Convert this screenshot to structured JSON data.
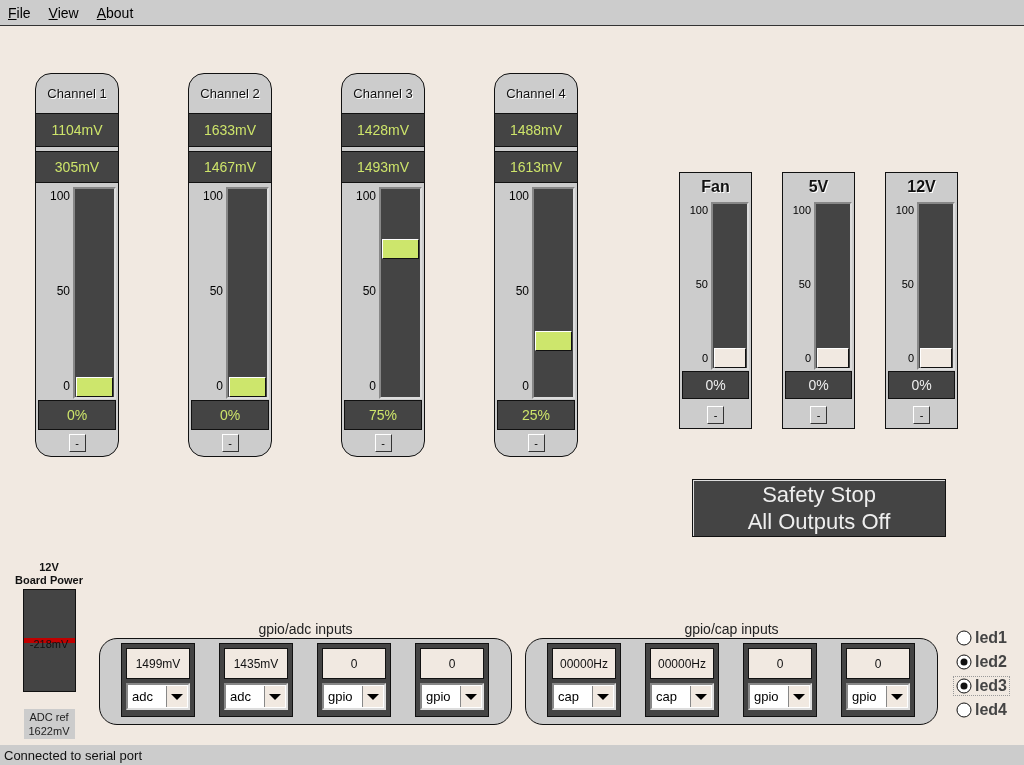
{
  "menu": [
    "File",
    "View",
    "About"
  ],
  "channels": [
    {
      "title": "Channel 1",
      "reading_1": "1104mV",
      "reading_2": "305mV",
      "scale": [
        "100",
        "50",
        "0"
      ],
      "level": 0,
      "percent": "0%",
      "button": "-"
    },
    {
      "title": "Channel 2",
      "reading_1": "1633mV",
      "reading_2": "1467mV",
      "scale": [
        "100",
        "50",
        "0"
      ],
      "level": 0,
      "percent": "0%",
      "button": "-"
    },
    {
      "title": "Channel 3",
      "reading_1": "1428mV",
      "reading_2": "1493mV",
      "scale": [
        "100",
        "50",
        "0"
      ],
      "level": 0.75,
      "percent": "75%",
      "button": "-"
    },
    {
      "title": "Channel 4",
      "reading_1": "1488mV",
      "reading_2": "1613mV",
      "scale": [
        "100",
        "50",
        "0"
      ],
      "level": 0.25,
      "percent": "25%",
      "button": "-"
    }
  ],
  "outputs": [
    {
      "title": "Fan",
      "scale": [
        "100",
        "50",
        "0"
      ],
      "level": 0,
      "percent": "0%",
      "button": "-"
    },
    {
      "title": "5V",
      "scale": [
        "100",
        "50",
        "0"
      ],
      "level": 0,
      "percent": "0%",
      "button": "-"
    },
    {
      "title": "12V",
      "scale": [
        "100",
        "50",
        "0"
      ],
      "level": 0,
      "percent": "0%",
      "button": "-"
    }
  ],
  "safety_button": [
    "Safety Stop",
    "All Outputs Off"
  ],
  "board_power": {
    "title": [
      "12V",
      "Board Power"
    ],
    "reading": "-218mV",
    "level": 0.5,
    "adc_ref": [
      "ADC ref",
      "1622mV"
    ]
  },
  "groups": [
    {
      "title": "gpio/adc inputs",
      "inputs": [
        {
          "value": "1499mV",
          "mode": "adc"
        },
        {
          "value": "1435mV",
          "mode": "adc"
        },
        {
          "value": "0",
          "mode": "gpio"
        },
        {
          "value": "0",
          "mode": "gpio"
        }
      ]
    },
    {
      "title": "gpio/cap inputs",
      "inputs": [
        {
          "value": "00000Hz",
          "mode": "cap"
        },
        {
          "value": "00000Hz",
          "mode": "cap"
        },
        {
          "value": "0",
          "mode": "gpio"
        },
        {
          "value": "0",
          "mode": "gpio"
        }
      ]
    }
  ],
  "leds": [
    {
      "label": "led1",
      "selected": false,
      "focused": false
    },
    {
      "label": "led2",
      "selected": true,
      "focused": false
    },
    {
      "label": "led3",
      "selected": true,
      "focused": true
    },
    {
      "label": "led4",
      "selected": false,
      "focused": false
    }
  ],
  "status_bar": "Connected to serial port"
}
